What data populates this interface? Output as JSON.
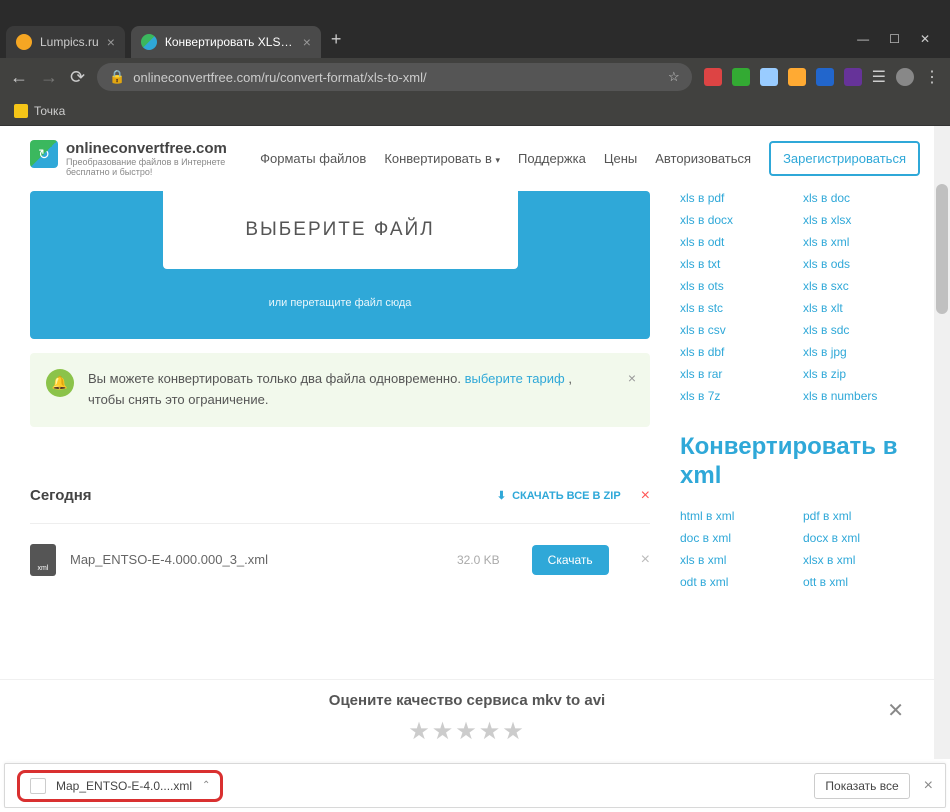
{
  "browser": {
    "tabs": [
      {
        "title": "Lumpics.ru",
        "active": false
      },
      {
        "title": "Конвертировать XLS в XML онл",
        "active": true
      }
    ],
    "url": "onlineconvertfree.com/ru/convert-format/xls-to-xml/",
    "bookmark": "Точка",
    "win": {
      "min": "—",
      "max": "☐",
      "close": "✕"
    }
  },
  "site": {
    "logo_title": "onlineconvertfree.com",
    "logo_sub": "Преобразование файлов в Интернете бесплатно и быстро!",
    "nav": {
      "formats": "Форматы файлов",
      "convert": "Конвертировать в",
      "support": "Поддержка",
      "prices": "Цены",
      "login": "Авторизоваться",
      "register": "Зарегистрироваться"
    }
  },
  "upload": {
    "button": "ВЫБЕРИТЕ ФАЙЛ",
    "drag": "или перетащите файл сюда"
  },
  "notice": {
    "text1": "Вы можете конвертировать только два файла одновременно. ",
    "link": "выберите тариф",
    "text2": " , чтобы снять это ограничение."
  },
  "section": {
    "title": "Сегодня",
    "zip": "СКАЧАТЬ ВСЕ В ZIP"
  },
  "file": {
    "name": "Map_ENTSO-E-4.000.000_3_.xml",
    "size": "32.0 KB",
    "download": "Скачать",
    "ext": "xml"
  },
  "sidebar": {
    "links1": [
      "xls в pdf",
      "xls в doc",
      "xls в docx",
      "xls в xlsx",
      "xls в odt",
      "xls в xml",
      "xls в txt",
      "xls в ods",
      "xls в ots",
      "xls в sxc",
      "xls в stc",
      "xls в xlt",
      "xls в csv",
      "xls в sdc",
      "xls в dbf",
      "xls в jpg",
      "xls в rar",
      "xls в zip",
      "xls в 7z",
      "xls в numbers"
    ],
    "heading": "Конвертировать в xml",
    "links2": [
      "html в xml",
      "pdf в xml",
      "doc в xml",
      "docx в xml",
      "xls в xml",
      "xlsx в xml",
      "odt в xml",
      "ott в xml"
    ]
  },
  "rating": {
    "title": "Оцените качество сервиса mkv to avi"
  },
  "download_bar": {
    "item": "Map_ENTSO-E-4.0....xml",
    "show_all": "Показать все"
  }
}
